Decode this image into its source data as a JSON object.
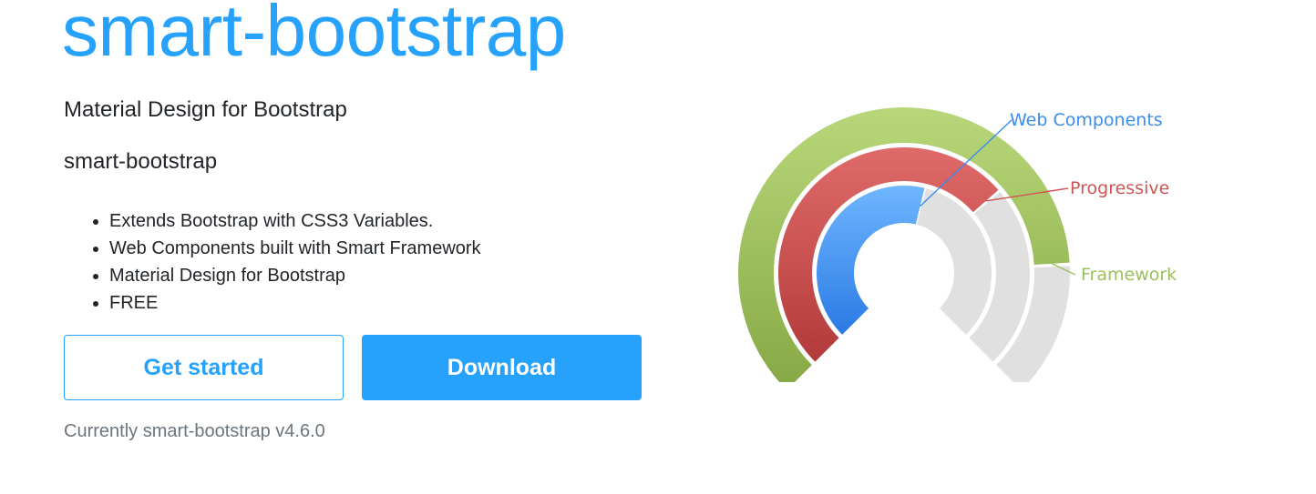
{
  "hero": {
    "title": "smart-bootstrap",
    "subtitle": "Material Design for Bootstrap",
    "name": "smart-bootstrap"
  },
  "features": [
    "Extends Bootstrap with CSS3 Variables.",
    "Web Components built with Smart Framework",
    "Material Design for Bootstrap",
    "FREE"
  ],
  "buttons": {
    "get_started": "Get started",
    "download": "Download"
  },
  "version_text": "Currently smart-bootstrap v4.6.0",
  "colors": {
    "accent": "#26a2fc",
    "muted_text": "#6c757d"
  },
  "chart_data": {
    "type": "radial-progress",
    "series": [
      {
        "name": "Web Components",
        "color": "#3a8cf0",
        "fill_fraction": 0.55
      },
      {
        "name": "Progressive",
        "color": "#d05555",
        "fill_fraction": 0.68
      },
      {
        "name": "Framework",
        "color": "#9cc05c",
        "fill_fraction": 0.82
      }
    ],
    "track_color": "#e0e0e0"
  }
}
